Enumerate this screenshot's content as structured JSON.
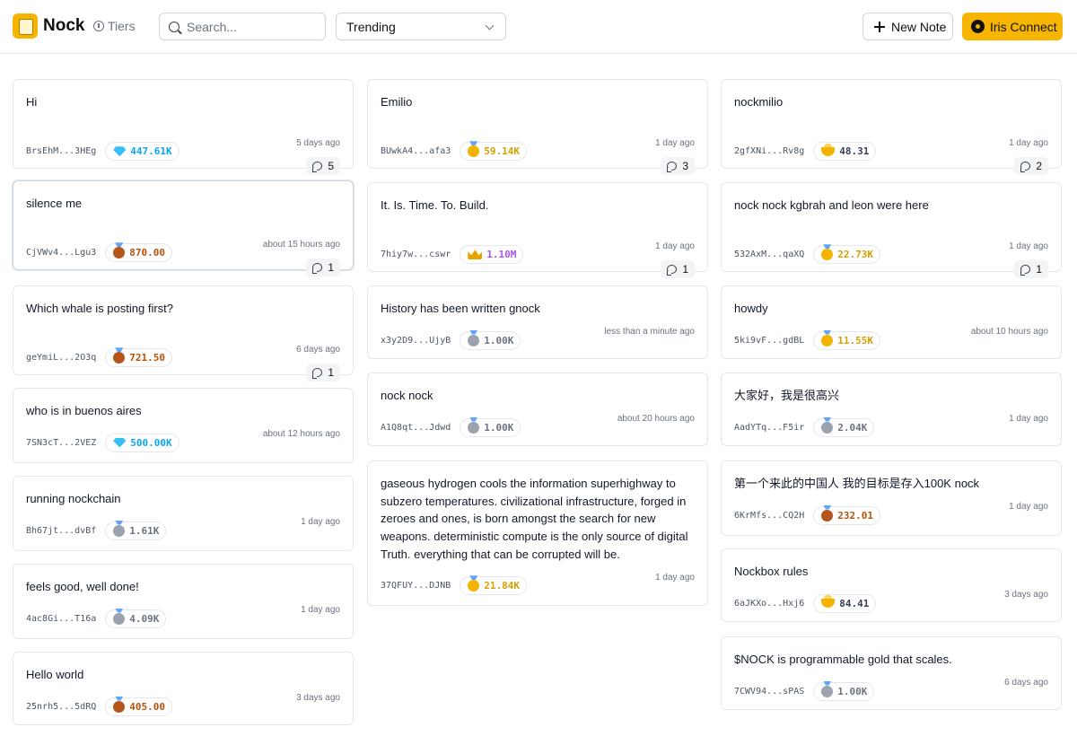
{
  "app": {
    "name": "Nock",
    "tiers_label": "Tiers",
    "search_placeholder": "Search...",
    "sort_selected": "Trending",
    "new_note_label": "New Note",
    "connect_label": "Iris Connect",
    "accent_color": "#f7b500"
  },
  "tier_colors": {
    "gem": "#0ea5e9",
    "gold": "#d4a000",
    "bronze": "#b45309",
    "silver": "#6b7280",
    "crown": "#a855f7",
    "bowl": "#374151"
  },
  "columns": [
    [
      {
        "title": "Hi",
        "address": "BrsEhM...3HEg",
        "amount": "447.61K",
        "tier": "gem",
        "time": "5 days ago",
        "comments": "5"
      },
      {
        "title": "silence me",
        "address": "CjVWv4...Lgu3",
        "amount": "870.00",
        "tier": "bronze",
        "time": "about 15 hours ago",
        "comments": "1"
      },
      {
        "title": "Which whale is posting first?",
        "address": "geYmiL...2O3q",
        "amount": "721.50",
        "tier": "bronze",
        "time": "6 days ago",
        "comments": "1"
      },
      {
        "title": "who is in buenos aires",
        "address": "7SN3cT...2VEZ",
        "amount": "500.00K",
        "tier": "gem",
        "time": "about 12 hours ago"
      },
      {
        "title": "running nockchain",
        "address": "Bh67jt...dvBf",
        "amount": "1.61K",
        "tier": "silver",
        "time": "1 day ago"
      },
      {
        "title": "feels good, well done!",
        "address": "4ac8Gi...T16a",
        "amount": "4.09K",
        "tier": "silver",
        "time": "1 day ago"
      },
      {
        "title": "Hello world",
        "address": "25nrh5...5dRQ",
        "amount": "405.00",
        "tier": "bronze",
        "time": "3 days ago"
      }
    ],
    [
      {
        "title": "Emilio",
        "address": "BUwkA4...afa3",
        "amount": "59.14K",
        "tier": "gold",
        "time": "1 day ago",
        "comments": "3"
      },
      {
        "title": "It. Is. Time. To. Build.",
        "address": "7hiy7w...cswr",
        "amount": "1.10M",
        "tier": "crown",
        "time": "1 day ago",
        "comments": "1"
      },
      {
        "title": "History has been written gnock",
        "address": "x3y2D9...UjyB",
        "amount": "1.00K",
        "tier": "silver",
        "time": "less than a minute ago"
      },
      {
        "title": "nock nock",
        "address": "A1Q8qt...Jdwd",
        "amount": "1.00K",
        "tier": "silver",
        "time": "about 20 hours ago"
      },
      {
        "title": "gaseous hydrogen cools the information superhighway to subzero temperatures. civilizational infrastructure, forged in zeroes and ones, is born amongst the search for new weapons. deterministic compute is the only source of digital Truth. everything that can be corrupted will be.",
        "address": "37QFUY...DJNB",
        "amount": "21.84K",
        "tier": "gold",
        "time": "1 day ago"
      }
    ],
    [
      {
        "title": "nockmilio",
        "address": "2gfXNi...Rv8g",
        "amount": "48.31",
        "tier": "bowl",
        "time": "1 day ago",
        "comments": "2"
      },
      {
        "title": "nock nock kgbrah and leon were here",
        "address": "532AxM...qaXQ",
        "amount": "22.73K",
        "tier": "gold",
        "time": "1 day ago",
        "comments": "1"
      },
      {
        "title": "howdy",
        "address": "5ki9vF...gdBL",
        "amount": "11.55K",
        "tier": "gold",
        "time": "about 10 hours ago"
      },
      {
        "title": "大家好，我是很高兴",
        "address": "AadYTq...F5ir",
        "amount": "2.04K",
        "tier": "silver",
        "time": "1 day ago"
      },
      {
        "title": "第一个来此的中国人 我的目标是存入100K nock",
        "address": "6KrMfs...CQ2H",
        "amount": "232.01",
        "tier": "bronze",
        "time": "1 day ago"
      },
      {
        "title": "Nockbox rules",
        "address": "6aJKXo...Hxj6",
        "amount": "84.41",
        "tier": "bowl",
        "time": "3 days ago"
      },
      {
        "title": "$NOCK is programmable gold that scales.",
        "address": "7CWV94...sPAS",
        "amount": "1.00K",
        "tier": "silver",
        "time": "6 days ago"
      }
    ]
  ]
}
